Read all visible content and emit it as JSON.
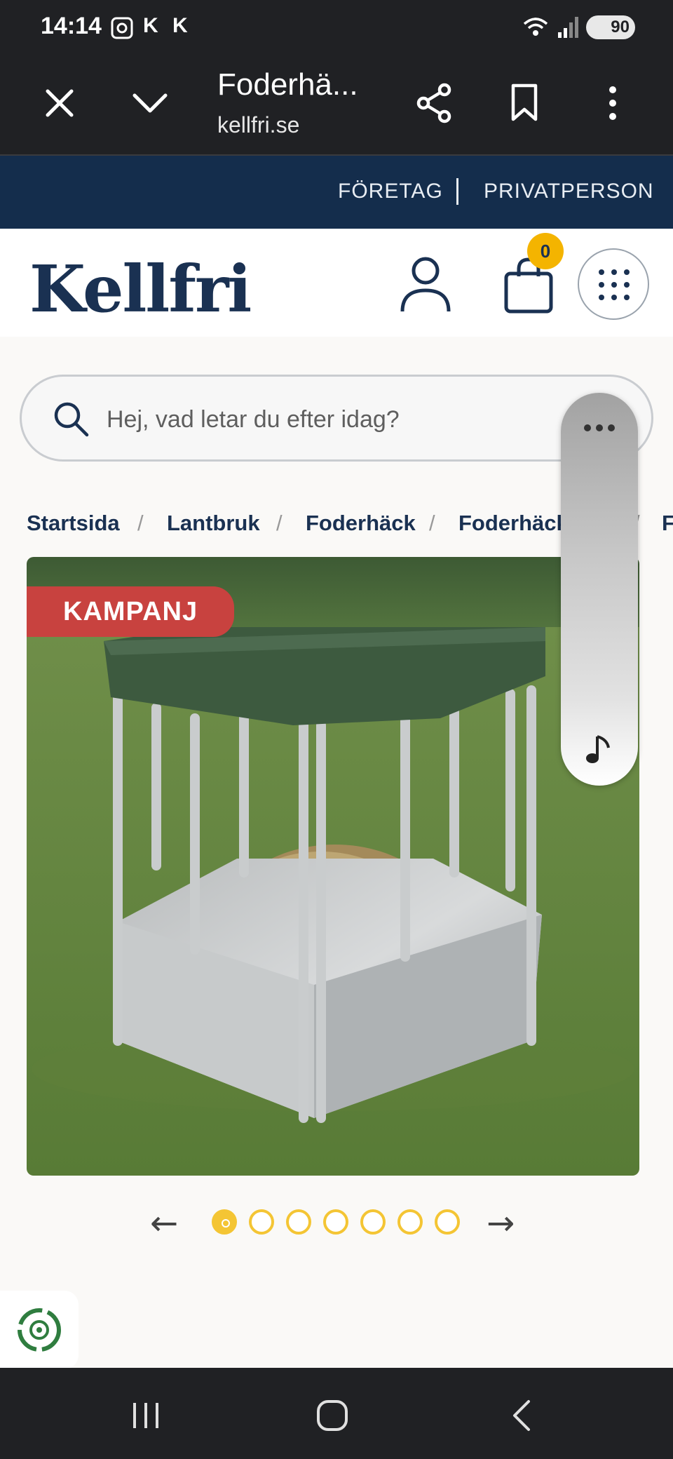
{
  "status_bar": {
    "time": "14:14",
    "k1": "K",
    "k2": "K",
    "battery": "90"
  },
  "browser": {
    "tab_title": "Foderhä...",
    "domain": "kellfri.se"
  },
  "top_strip": {
    "business": "FÖRETAG",
    "private": "PRIVATPERSON"
  },
  "header": {
    "logo": "Kellfri",
    "cart_count": "0"
  },
  "search": {
    "placeholder": "Hej, vad letar du efter idag?"
  },
  "breadcrumb": [
    "Startsida",
    "Lantbruk",
    "Foderhäck",
    "Foderhäck",
    "F"
  ],
  "product": {
    "badge": "KAMPANJ",
    "image_count": 7,
    "active_image": 1
  },
  "carousel": {
    "prev": "←",
    "next": "→"
  },
  "colors": {
    "navy": "#142d4c",
    "accent_yellow": "#f4c534",
    "badge_red": "#c8423f"
  }
}
